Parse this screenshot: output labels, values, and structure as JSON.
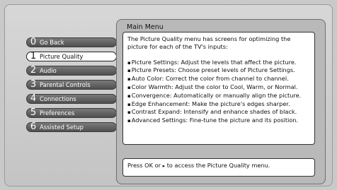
{
  "panel": {
    "title": "Main Menu"
  },
  "content": {
    "intro": "The Picture Quality menu has screens for optimizing the picture for each of the TV's inputs:",
    "bullets": [
      "Picture Settings: Adjust the levels that affect the picture.",
      "Picture Presets: Choose preset levels of Picture Settings.",
      "Auto Color: Correct the color from channel to channel.",
      "Color Warmth: Adjust the color to Cool, Warm, or Normal.",
      "Convergence: Automatically or manually align the picture.",
      "Edge Enhancement: Make the picture's edges sharper.",
      "Contrast Expand: Intensify and enhance shades of black.",
      "Advanced Settings: Fine-tune the picture and its position."
    ]
  },
  "footer": {
    "text_before": "Press OK or",
    "arrow": "▸",
    "text_after": "to access the Picture Quality menu."
  },
  "menu": {
    "items": [
      {
        "num": "0",
        "label": "Go Back",
        "selected": false
      },
      {
        "num": "1",
        "label": "Picture Quality",
        "selected": true
      },
      {
        "num": "2",
        "label": "Audio",
        "selected": false
      },
      {
        "num": "3",
        "label": "Parental Controls",
        "selected": false
      },
      {
        "num": "4",
        "label": "Connections",
        "selected": false
      },
      {
        "num": "5",
        "label": "Preferences",
        "selected": false
      },
      {
        "num": "6",
        "label": "Assisted Setup",
        "selected": false
      }
    ]
  }
}
